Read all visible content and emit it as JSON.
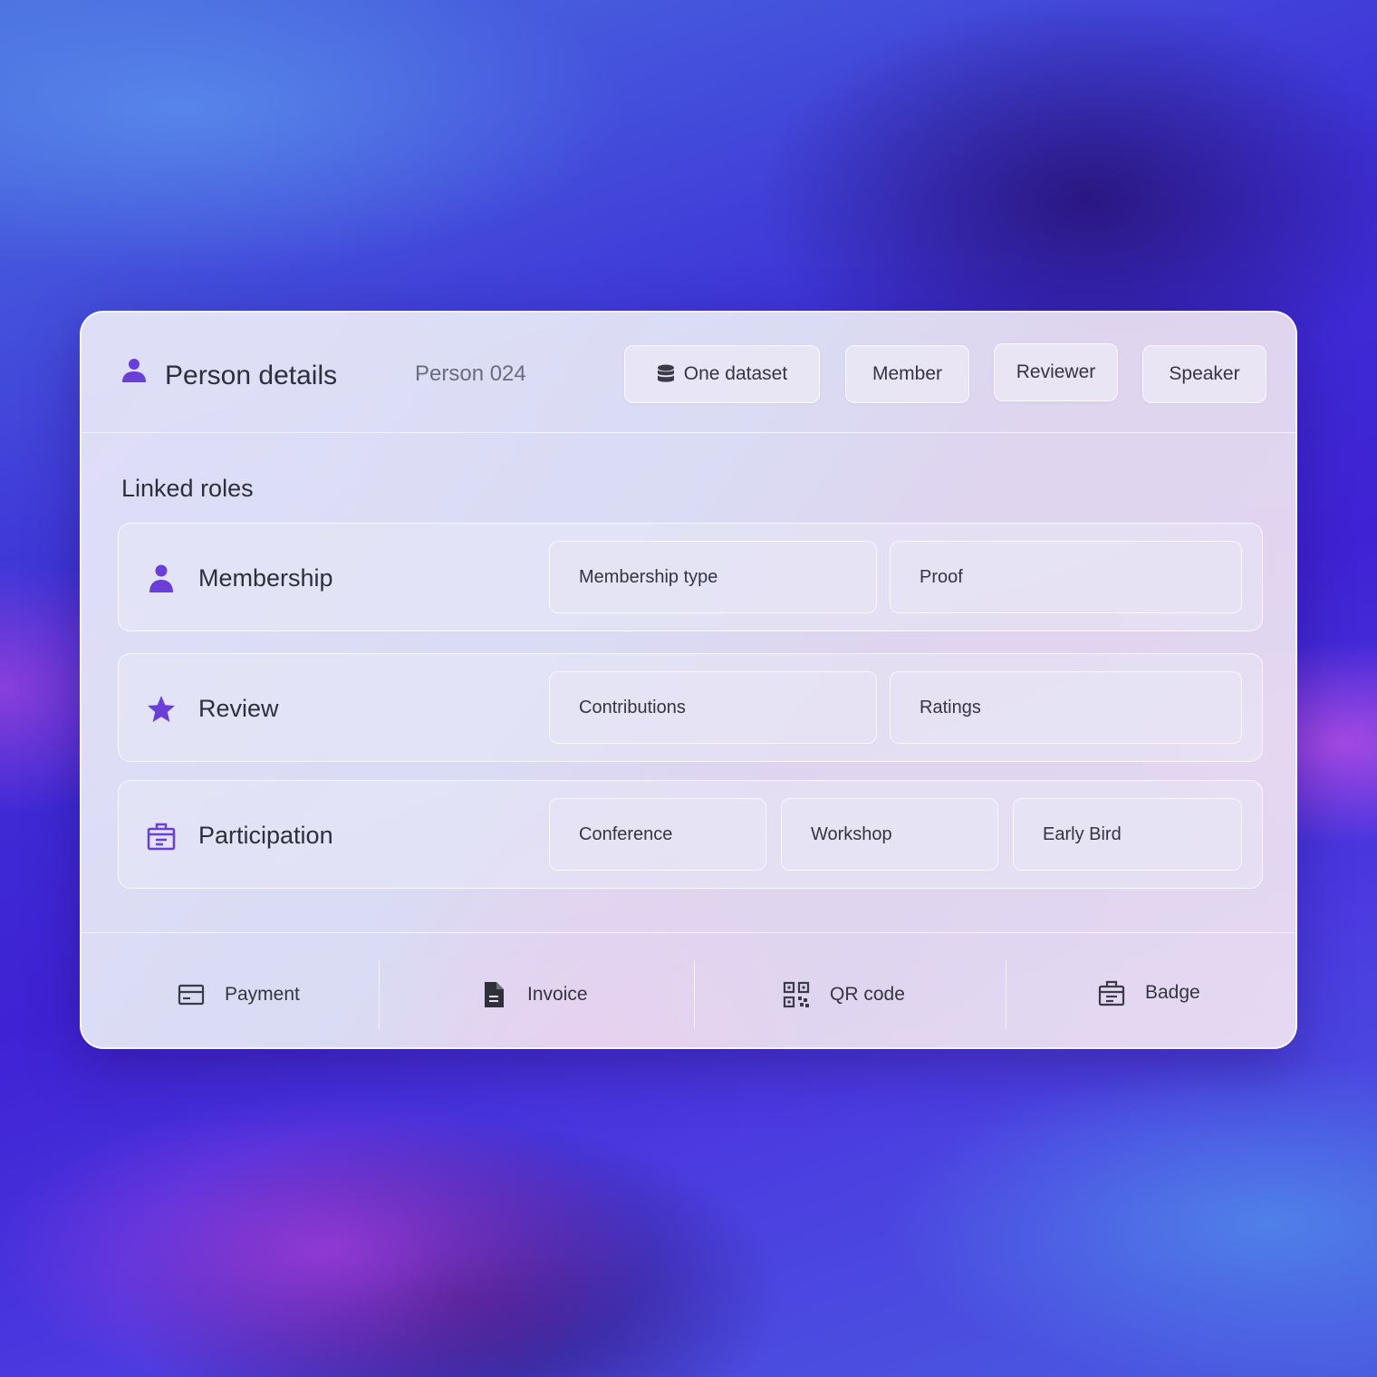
{
  "colors": {
    "accent": "#6a3fd8",
    "icon_dark": "#3a3b46",
    "text": "#2e2f3a",
    "muted_text": "#6b6d7a"
  },
  "header": {
    "icon": "person-icon",
    "title": "Person details",
    "subtitle": "Person 024",
    "chips": [
      {
        "label": "One dataset",
        "icon": "database-icon"
      },
      {
        "label": "Member"
      },
      {
        "label": "Reviewer"
      },
      {
        "label": "Speaker"
      }
    ]
  },
  "linked_roles": {
    "title": "Linked roles",
    "rows": [
      {
        "label": "Membership",
        "icon": "person-icon",
        "fields": [
          "Membership type",
          "Proof"
        ]
      },
      {
        "label": "Review",
        "icon": "star-icon",
        "fields": [
          "Contributions",
          "Ratings"
        ]
      },
      {
        "label": "Participation",
        "icon": "badge-icon",
        "fields": [
          "Conference",
          "Workshop",
          "Early Bird"
        ]
      }
    ]
  },
  "footer": {
    "items": [
      {
        "label": "Payment",
        "icon": "card-icon"
      },
      {
        "label": "Invoice",
        "icon": "document-icon"
      },
      {
        "label": "QR code",
        "icon": "qr-code-icon"
      },
      {
        "label": "Badge",
        "icon": "badge-icon"
      }
    ]
  }
}
